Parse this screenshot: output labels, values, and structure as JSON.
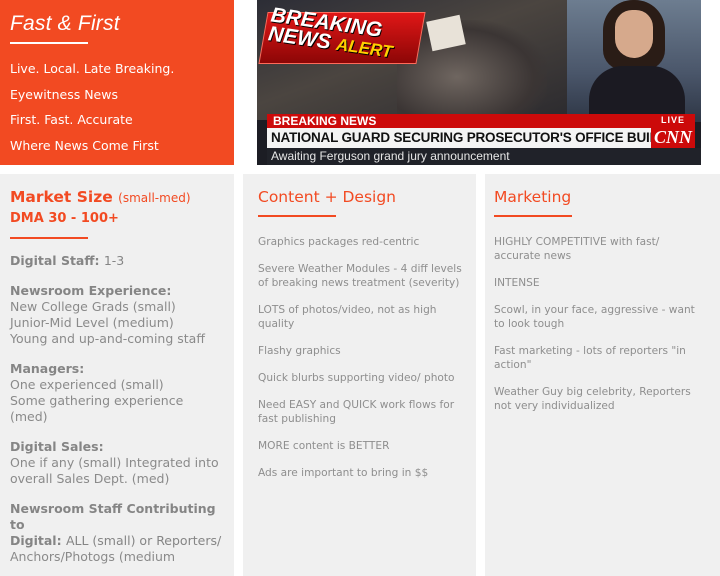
{
  "hero": {
    "title": "Fast & First",
    "lines": [
      "Live. Local. Late Breaking.",
      "Eyewitness News",
      "First. Fast. Accurate",
      "Where News Come First"
    ]
  },
  "tv": {
    "badge_line1": "BREAKING",
    "badge_line2": "NEWS",
    "badge_line3": "ALERT",
    "red_bar": "BREAKING NEWS",
    "headline": "NATIONAL GUARD SECURING PROSECUTOR'S OFFICE BUILDING",
    "subline": "Awaiting Ferguson grand jury announcement",
    "live": "LIVE",
    "logo": "CNN"
  },
  "market": {
    "heading": "Market Size",
    "heading_note": "(small-med)",
    "dma": "DMA 30 - 100+",
    "groups": [
      {
        "label": "Digital Staff:",
        "value": "1-3"
      },
      {
        "label": "Newsroom Experience:",
        "lines": [
          "New College Grads (small)",
          "Junior-Mid Level (medium)",
          "Young and up-and-coming staff"
        ]
      },
      {
        "label": "Managers:",
        "lines": [
          "One experienced (small)",
          "Some gathering experience",
          "(med)"
        ]
      },
      {
        "label": "Digital Sales:",
        "lines": [
          "One if any (small) Integrated into",
          "overall Sales Dept. (med)"
        ]
      },
      {
        "label": "Newsroom Staff Contributing to",
        "label2": "Digital:",
        "value2": "ALL (small) or Reporters/",
        "lines": [
          "Anchors/Photogs (medium"
        ]
      }
    ]
  },
  "content": {
    "heading": "Content + Design",
    "items": [
      "Graphics packages red-centric",
      "Severe Weather Modules - 4 diff levels of breaking news treatment (severity)",
      "LOTS of photos/video, not as high quality",
      "Flashy graphics",
      "Quick blurbs supporting video/ photo",
      "Need EASY and QUICK work flows for fast publishing",
      "MORE content is BETTER",
      "Ads are important to bring in $$"
    ]
  },
  "marketing": {
    "heading": "Marketing",
    "items": [
      "HIGHLY COMPETITIVE with fast/ accurate news",
      "INTENSE",
      "Scowl, in your face, aggressive - want to look tough",
      "Fast marketing - lots of reporters \"in action\"",
      "Weather Guy big celebrity, Reporters not very individualized"
    ]
  },
  "colors": {
    "accent": "#f24a22",
    "panel": "#f0f0f0",
    "text": "#8a8a8a"
  }
}
